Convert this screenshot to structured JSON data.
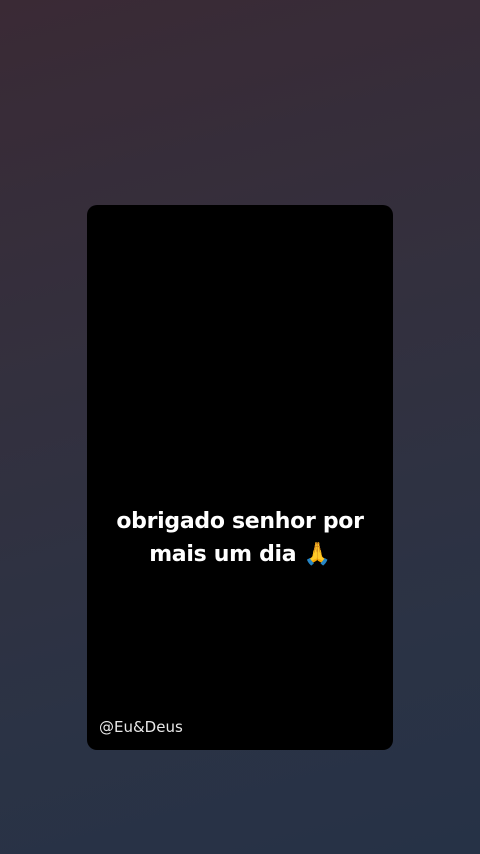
{
  "story": {
    "caption_line1": "obrigado senhor por",
    "caption_line2": "mais um dia 🙏",
    "watermark": "@Eu&Deus"
  },
  "colors": {
    "background_top": "#3a2a35",
    "background_bottom": "#263246",
    "card": "#000000",
    "text": "#ffffff"
  }
}
